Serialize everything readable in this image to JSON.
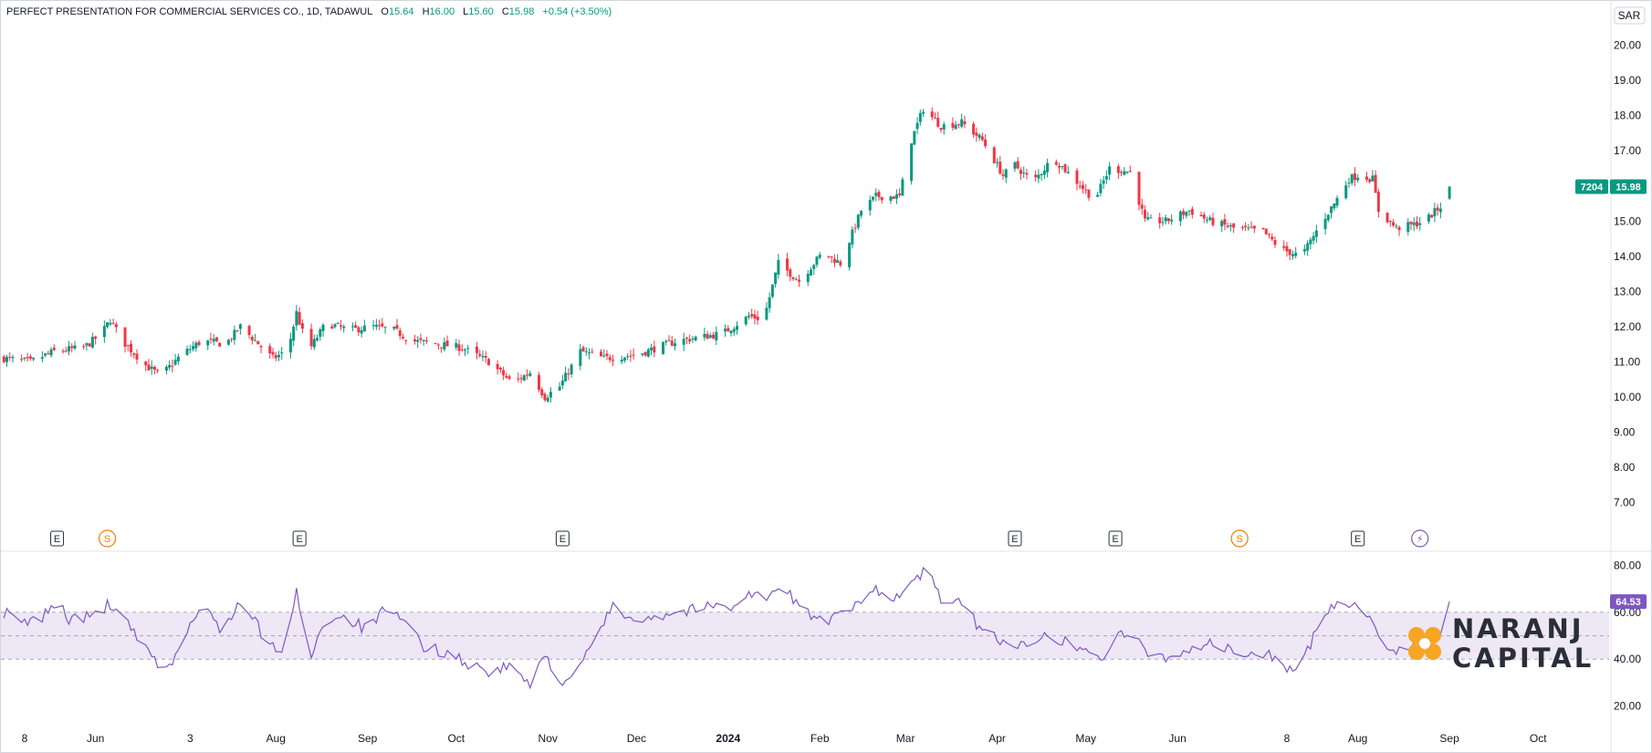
{
  "legend": {
    "title": "PERFECT PRESENTATION FOR COMMERCIAL SERVICES CO., 1D, TADAWUL",
    "o_label": "O",
    "o": "15.64",
    "h_label": "H",
    "h": "16.00",
    "l_label": "L",
    "l": "15.60",
    "c_label": "C",
    "c": "15.98",
    "change": "+0.54 (+3.50%)"
  },
  "currency": "SAR",
  "price_badge": {
    "volume": "7204",
    "price": "15.98"
  },
  "rsi_badge": "64.53",
  "logo": {
    "line1": "NARANJ",
    "line2": "CAPITAL"
  },
  "colors": {
    "up": "#089981",
    "down": "#f23645",
    "rsi_line": "#7e57c2",
    "rsi_band": "#ede7f6",
    "badge_green": "#089981",
    "badge_purple": "#7e57c2",
    "logo_orange": "#f5a623"
  },
  "event_markers": [
    {
      "label": "E",
      "date": "2023-05-19",
      "kind": "earnings"
    },
    {
      "label": "S",
      "date": "2023-06-05",
      "kind": "split"
    },
    {
      "label": "E",
      "date": "2023-08-09",
      "kind": "earnings"
    },
    {
      "label": "E",
      "date": "2023-11-06",
      "kind": "earnings"
    },
    {
      "label": "E",
      "date": "2024-04-07",
      "kind": "earnings"
    },
    {
      "label": "E",
      "date": "2024-05-11",
      "kind": "earnings"
    },
    {
      "label": "S",
      "date": "2024-06-22",
      "kind": "split"
    },
    {
      "label": "E",
      "date": "2024-08-01",
      "kind": "earnings"
    },
    {
      "label": "⚡",
      "date": "2024-08-22",
      "kind": "flash"
    }
  ],
  "chart_data": [
    {
      "type": "candlestick",
      "title": "",
      "y_ticks": [
        "20.00",
        "19.00",
        "18.00",
        "17.00",
        "16.00",
        "15.00",
        "14.00",
        "13.00",
        "12.00",
        "11.00",
        "10.00",
        "9.00",
        "8.00",
        "7.00"
      ],
      "ylim": [
        6.6,
        20.3
      ],
      "x_ticks": [
        "8",
        "Jun",
        "3",
        "Aug",
        "Sep",
        "Oct",
        "Nov",
        "Dec",
        "2024",
        "Feb",
        "Mar",
        "Apr",
        "May",
        "Jun",
        "8",
        "Aug",
        "Sep",
        "Oct"
      ],
      "x_tick_dates": [
        "2023-05-08",
        "2023-06-01",
        "2023-07-03",
        "2023-08-01",
        "2023-09-01",
        "2023-10-01",
        "2023-11-01",
        "2023-12-01",
        "2024-01-01",
        "2024-02-01",
        "2024-03-01",
        "2024-04-01",
        "2024-05-01",
        "2024-06-01",
        "2024-07-08",
        "2024-08-01",
        "2024-09-01",
        "2024-10-01"
      ],
      "xlim": [
        "2023-04-30",
        "2024-10-25"
      ],
      "anchors": [
        [
          "2023-05-01",
          11.1
        ],
        [
          "2023-05-10",
          11.0
        ],
        [
          "2023-05-18",
          11.3
        ],
        [
          "2023-05-28",
          11.4
        ],
        [
          "2023-06-03",
          11.8
        ],
        [
          "2023-06-06",
          12.2
        ],
        [
          "2023-06-10",
          11.6
        ],
        [
          "2023-06-18",
          10.9
        ],
        [
          "2023-06-23",
          10.6
        ],
        [
          "2023-06-30",
          11.2
        ],
        [
          "2023-07-07",
          11.6
        ],
        [
          "2023-07-15",
          11.5
        ],
        [
          "2023-07-20",
          12.0
        ],
        [
          "2023-07-25",
          11.6
        ],
        [
          "2023-07-31",
          11.1
        ],
        [
          "2023-08-05",
          11.3
        ],
        [
          "2023-08-08",
          12.4
        ],
        [
          "2023-08-12",
          11.3
        ],
        [
          "2023-08-18",
          12.1
        ],
        [
          "2023-08-26",
          11.9
        ],
        [
          "2023-09-03",
          12.0
        ],
        [
          "2023-09-10",
          11.9
        ],
        [
          "2023-09-16",
          11.6
        ],
        [
          "2023-09-25",
          11.5
        ],
        [
          "2023-10-03",
          11.4
        ],
        [
          "2023-10-12",
          11.0
        ],
        [
          "2023-10-20",
          10.4
        ],
        [
          "2023-10-26",
          10.7
        ],
        [
          "2023-10-31",
          10.0
        ],
        [
          "2023-11-05",
          10.3
        ],
        [
          "2023-11-12",
          11.3
        ],
        [
          "2023-11-20",
          11.1
        ],
        [
          "2023-12-01",
          11.2
        ],
        [
          "2023-12-15",
          11.6
        ],
        [
          "2023-12-30",
          11.8
        ],
        [
          "2024-01-08",
          12.3
        ],
        [
          "2024-01-13",
          12.2
        ],
        [
          "2024-01-18",
          13.8
        ],
        [
          "2024-01-25",
          13.3
        ],
        [
          "2024-02-02",
          14.1
        ],
        [
          "2024-02-08",
          13.8
        ],
        [
          "2024-02-15",
          15.3
        ],
        [
          "2024-02-20",
          15.7
        ],
        [
          "2024-02-28",
          15.7
        ],
        [
          "2024-03-03",
          17.3
        ],
        [
          "2024-03-07",
          18.2
        ],
        [
          "2024-03-13",
          17.7
        ],
        [
          "2024-03-20",
          17.8
        ],
        [
          "2024-03-27",
          17.3
        ],
        [
          "2024-04-03",
          16.3
        ],
        [
          "2024-04-07",
          16.6
        ],
        [
          "2024-04-13",
          16.1
        ],
        [
          "2024-04-20",
          16.8
        ],
        [
          "2024-04-27",
          16.2
        ],
        [
          "2024-05-04",
          15.6
        ],
        [
          "2024-05-09",
          16.5
        ],
        [
          "2024-05-16",
          16.4
        ],
        [
          "2024-05-21",
          15.0
        ],
        [
          "2024-05-28",
          15.0
        ],
        [
          "2024-06-05",
          15.3
        ],
        [
          "2024-06-12",
          15.0
        ],
        [
          "2024-06-20",
          14.8
        ],
        [
          "2024-06-30",
          14.7
        ],
        [
          "2024-07-06",
          14.2
        ],
        [
          "2024-07-13",
          14.0
        ],
        [
          "2024-07-20",
          15.0
        ],
        [
          "2024-07-24",
          15.5
        ],
        [
          "2024-07-29",
          16.2
        ],
        [
          "2024-08-01",
          16.3
        ],
        [
          "2024-08-06",
          16.2
        ],
        [
          "2024-08-08",
          15.3
        ],
        [
          "2024-08-14",
          14.8
        ],
        [
          "2024-08-20",
          14.9
        ],
        [
          "2024-08-25",
          15.1
        ],
        [
          "2024-08-30",
          15.5
        ],
        [
          "2024-09-01",
          15.98
        ]
      ]
    },
    {
      "type": "line",
      "title": "",
      "y_ticks": [
        "80.00",
        "60.00",
        "40.00",
        "20.00"
      ],
      "ylim": [
        16,
        84
      ],
      "bands": {
        "upper": 60,
        "middle": 50,
        "lower": 40
      },
      "anchors": [
        [
          "2023-05-01",
          60
        ],
        [
          "2023-05-08",
          55
        ],
        [
          "2023-05-14",
          58
        ],
        [
          "2023-05-19",
          65
        ],
        [
          "2023-05-23",
          57
        ],
        [
          "2023-05-30",
          58
        ],
        [
          "2023-06-05",
          63
        ],
        [
          "2023-06-12",
          55
        ],
        [
          "2023-06-17",
          45
        ],
        [
          "2023-06-22",
          38
        ],
        [
          "2023-06-27",
          38
        ],
        [
          "2023-07-03",
          55
        ],
        [
          "2023-07-08",
          62
        ],
        [
          "2023-07-14",
          52
        ],
        [
          "2023-07-19",
          63
        ],
        [
          "2023-07-24",
          58
        ],
        [
          "2023-07-30",
          45
        ],
        [
          "2023-08-04",
          44
        ],
        [
          "2023-08-08",
          68
        ],
        [
          "2023-08-13",
          42
        ],
        [
          "2023-08-18",
          58
        ],
        [
          "2023-08-25",
          58
        ],
        [
          "2023-09-01",
          52
        ],
        [
          "2023-09-06",
          60
        ],
        [
          "2023-09-14",
          56
        ],
        [
          "2023-09-20",
          45
        ],
        [
          "2023-09-28",
          43
        ],
        [
          "2023-10-05",
          38
        ],
        [
          "2023-10-14",
          34
        ],
        [
          "2023-10-20",
          38
        ],
        [
          "2023-10-26",
          28
        ],
        [
          "2023-10-31",
          42
        ],
        [
          "2023-11-06",
          30
        ],
        [
          "2023-11-12",
          36
        ],
        [
          "2023-11-18",
          52
        ],
        [
          "2023-11-23",
          62
        ],
        [
          "2023-11-28",
          58
        ],
        [
          "2023-12-06",
          58
        ],
        [
          "2023-12-15",
          60
        ],
        [
          "2023-12-23",
          62
        ],
        [
          "2024-01-02",
          63
        ],
        [
          "2024-01-09",
          68
        ],
        [
          "2024-01-14",
          66
        ],
        [
          "2024-01-20",
          70
        ],
        [
          "2024-01-26",
          62
        ],
        [
          "2024-02-01",
          56
        ],
        [
          "2024-02-07",
          58
        ],
        [
          "2024-02-14",
          63
        ],
        [
          "2024-02-20",
          70
        ],
        [
          "2024-02-27",
          66
        ],
        [
          "2024-03-03",
          72
        ],
        [
          "2024-03-08",
          78
        ],
        [
          "2024-03-13",
          66
        ],
        [
          "2024-03-20",
          63
        ],
        [
          "2024-03-27",
          52
        ],
        [
          "2024-04-03",
          48
        ],
        [
          "2024-04-10",
          45
        ],
        [
          "2024-04-17",
          52
        ],
        [
          "2024-04-23",
          48
        ],
        [
          "2024-05-01",
          44
        ],
        [
          "2024-05-07",
          40
        ],
        [
          "2024-05-12",
          52
        ],
        [
          "2024-05-17",
          49
        ],
        [
          "2024-05-22",
          42
        ],
        [
          "2024-05-29",
          41
        ],
        [
          "2024-06-05",
          44
        ],
        [
          "2024-06-11",
          47
        ],
        [
          "2024-06-18",
          44
        ],
        [
          "2024-06-26",
          41
        ],
        [
          "2024-07-02",
          43
        ],
        [
          "2024-07-08",
          35
        ],
        [
          "2024-07-13",
          36
        ],
        [
          "2024-07-18",
          54
        ],
        [
          "2024-07-22",
          62
        ],
        [
          "2024-07-27",
          64
        ],
        [
          "2024-08-01",
          64
        ],
        [
          "2024-08-05",
          58
        ],
        [
          "2024-08-09",
          46
        ],
        [
          "2024-08-14",
          44
        ],
        [
          "2024-08-20",
          47
        ],
        [
          "2024-08-24",
          50
        ],
        [
          "2024-08-29",
          52
        ],
        [
          "2024-09-01",
          64.53
        ]
      ]
    }
  ]
}
